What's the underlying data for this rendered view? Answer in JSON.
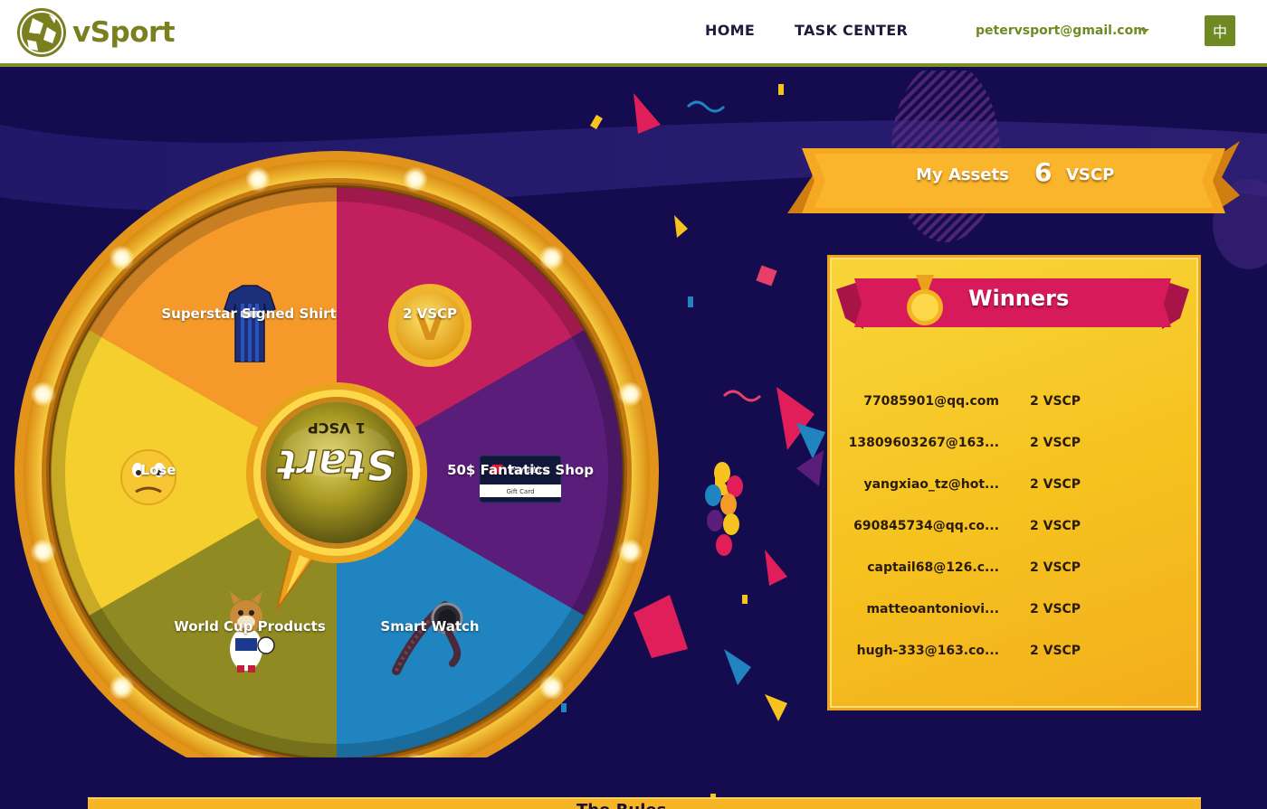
{
  "header": {
    "logo_text": "vSport",
    "nav": {
      "home": "HOME",
      "task_center": "TASK CENTER"
    },
    "user_email": "petervsport@gmail.com",
    "lang_button": "中"
  },
  "wheel": {
    "start_label": "Start",
    "start_cost": "1 VSCP",
    "slices": [
      {
        "label": "Superstar Signed Shirt",
        "color": "#f59a2a",
        "icon": "shirt-icon"
      },
      {
        "label": "2 VSCP",
        "color": "#c21f5f",
        "icon": "coin-icon"
      },
      {
        "label": "50$ Fantatics Shop",
        "color": "#5a1d79",
        "icon": "gift-card-icon"
      },
      {
        "label": "Smart Watch",
        "color": "#1f84bf",
        "icon": "watch-icon"
      },
      {
        "label": "World Cup Products",
        "color": "#8f8a22",
        "icon": "mascot-icon"
      },
      {
        "label": "Lose",
        "color": "#f4cf2e",
        "icon": "sad-face-icon"
      }
    ],
    "gift_card": {
      "brand": "Fanatics",
      "caption": "Gift Card"
    },
    "coin_letter": "V"
  },
  "assets": {
    "label": "My Assets",
    "value": "6",
    "unit": "VSCP"
  },
  "winners": {
    "title": "Winners",
    "rows": [
      {
        "email": "77085901@qq.com",
        "prize": "2 VSCP"
      },
      {
        "email": "13809603267@163...",
        "prize": "2 VSCP"
      },
      {
        "email": "yangxiao_tz@hot...",
        "prize": "2 VSCP"
      },
      {
        "email": "690845734@qq.co...",
        "prize": "2 VSCP"
      },
      {
        "email": "captail68@126.c...",
        "prize": "2 VSCP"
      },
      {
        "email": "matteoantoniovi...",
        "prize": "2 VSCP"
      },
      {
        "email": "hugh-333@163.co...",
        "prize": "2 VSCP"
      }
    ]
  },
  "rules": {
    "title": "The Rules"
  },
  "colors": {
    "accent": "#7d8f2a",
    "background": "#140c4e",
    "gold": "#f6b526"
  }
}
